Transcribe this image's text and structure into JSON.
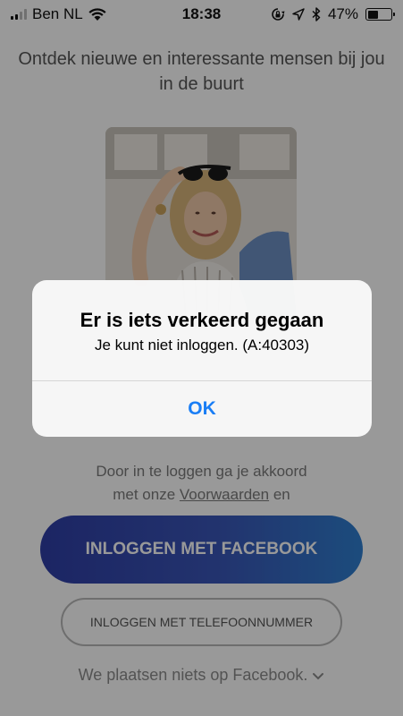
{
  "status_bar": {
    "carrier": "Ben NL",
    "time": "18:38",
    "battery_percent": "47%",
    "battery_level": 0.47,
    "icons": [
      "signal-icon",
      "wifi-icon",
      "orientation-lock-icon",
      "location-icon",
      "bluetooth-icon",
      "battery-icon"
    ]
  },
  "screen": {
    "tagline": "Ontdek nieuwe en interessante mensen bij jou in de buurt",
    "terms_prefix": "Door in te loggen ga je akkoord",
    "terms_middle": "met onze ",
    "terms_link": "Voorwaarden",
    "terms_suffix": " en",
    "facebook_button": "INLOGGEN MET FACEBOOK",
    "phone_button": "INLOGGEN MET TELEFOONNUMMER",
    "facebook_note": "We plaatsen niets op Facebook.",
    "accent_colors": {
      "facebook_gradient_start": "#2f3ea6",
      "facebook_gradient_end": "#2f7fd0",
      "alert_button": "#1a7ef5"
    }
  },
  "alert": {
    "title": "Er is iets verkeerd gegaan",
    "message": "Je kunt niet inloggen. (A:40303)",
    "ok_label": "OK"
  }
}
